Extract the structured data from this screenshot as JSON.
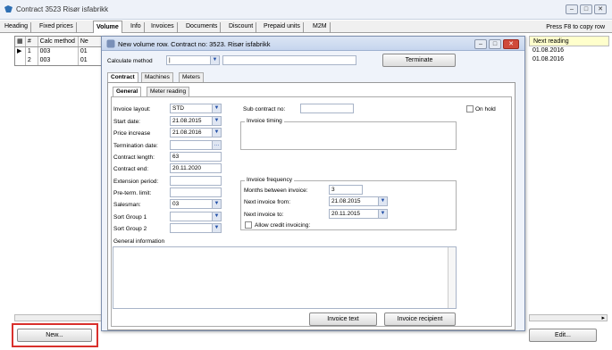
{
  "window": {
    "title": "Contract 3523  Risør isfabrikk"
  },
  "tabs": [
    "Heading",
    "Fixed prices",
    "Volume",
    "Info",
    "Invoices",
    "Documents",
    "Discount",
    "Prepaid units",
    "M2M"
  ],
  "tab_hint": "Press F8 to copy row",
  "grid": {
    "headers": [
      "#",
      "Calc method",
      "Ne"
    ],
    "rows": [
      [
        "1",
        "003",
        "01"
      ],
      [
        "2",
        "003",
        "01"
      ]
    ]
  },
  "right_column": {
    "header": "Next reading",
    "rows": [
      "01.08.2016",
      "01.08.2016"
    ]
  },
  "new_button": "New...",
  "edit_button": "Edit...",
  "dialog": {
    "title": "New volume row. Contract no: 3523. Risør isfabrikk",
    "calc_method_label": "Calculate method",
    "calc_method_value": "|",
    "terminate_button": "Terminate",
    "top_tabs": [
      "Contract",
      "Machines",
      "Meters"
    ],
    "sub_tabs": [
      "General",
      "Meter reading"
    ],
    "fields": {
      "invoice_layout_label": "Invoice layout:",
      "invoice_layout": "STD",
      "start_date_label": "Start date:",
      "start_date": "21.08.2015",
      "price_increase_label": "Price increase",
      "price_increase": "21.08.2016",
      "termination_date_label": "Termination date:",
      "termination_date": "",
      "contract_length_label": "Contract length:",
      "contract_length": "63",
      "contract_end_label": "Contract end:",
      "contract_end": "20.11.2020",
      "extension_period_label": "Extension period:",
      "extension_period": "",
      "pre_term_limit_label": "Pre-term. limit:",
      "pre_term_limit": "",
      "salesman_label": "Salesman:",
      "salesman": "03",
      "sort_group1_label": "Sort Group 1",
      "sort_group1": "",
      "sort_group2_label": "Sort Group 2",
      "sort_group2": "",
      "sub_contract_label": "Sub contract no:",
      "sub_contract": "",
      "on_hold_label": "On hold"
    },
    "invoice_timing_label": "Invoice timing",
    "invoice_frequency": {
      "label": "Invoice frequency",
      "months_label": "Months between  invoice:",
      "months": "3",
      "next_from_label": "Next invoice from:",
      "next_from": "21.08.2015",
      "next_to_label": "Next invoice to:",
      "next_to": "20.11.2015",
      "allow_credit_label": "Allow credit invoicing:"
    },
    "general_info_label": "General information",
    "invoice_text_button": "Invoice text",
    "invoice_recipient_button": "Invoice recipient"
  }
}
